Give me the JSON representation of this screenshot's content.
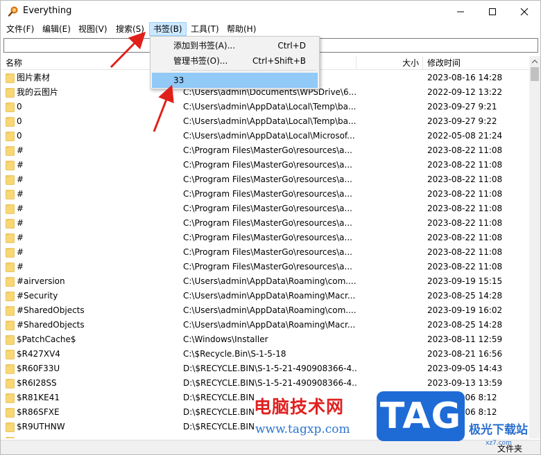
{
  "window": {
    "title": "Everything"
  },
  "menu": {
    "items": [
      "文件(F)",
      "编辑(E)",
      "视图(V)",
      "搜索(S)",
      "书签(B)",
      "工具(T)",
      "帮助(H)"
    ],
    "active_index": 4
  },
  "search": {
    "value": ""
  },
  "columns": {
    "name": "名称",
    "path": "",
    "size": "大小",
    "modified": "修改时间"
  },
  "bookmarks_menu": {
    "items": [
      {
        "label": "添加到书签(A)...",
        "shortcut": "Ctrl+D"
      },
      {
        "label": "管理书签(O)...",
        "shortcut": "Ctrl+Shift+B"
      }
    ],
    "bookmarks": [
      {
        "label": "33"
      }
    ]
  },
  "rows": [
    {
      "name": "图片素材",
      "path": "",
      "modified": "2023-08-16 14:28",
      "icon": "folder"
    },
    {
      "name": "我的云图片",
      "path": "C:\\Users\\admin\\Documents\\WPSDrive\\6...",
      "modified": "2022-09-12 13:22",
      "icon": "folder"
    },
    {
      "name": "0",
      "path": "C:\\Users\\admin\\AppData\\Local\\Temp\\ba...",
      "modified": "2023-09-27 9:21",
      "icon": "folder"
    },
    {
      "name": "0",
      "path": "C:\\Users\\admin\\AppData\\Local\\Temp\\ba...",
      "modified": "2023-09-27 9:22",
      "icon": "folder"
    },
    {
      "name": "0",
      "path": "C:\\Users\\admin\\AppData\\Local\\Microsof...",
      "modified": "2022-05-08 21:24",
      "icon": "folder"
    },
    {
      "name": "#",
      "path": "C:\\Program Files\\MasterGo\\resources\\a...",
      "modified": "2023-08-22 11:08",
      "icon": "folder"
    },
    {
      "name": "#",
      "path": "C:\\Program Files\\MasterGo\\resources\\a...",
      "modified": "2023-08-22 11:08",
      "icon": "folder"
    },
    {
      "name": "#",
      "path": "C:\\Program Files\\MasterGo\\resources\\a...",
      "modified": "2023-08-22 11:08",
      "icon": "folder"
    },
    {
      "name": "#",
      "path": "C:\\Program Files\\MasterGo\\resources\\a...",
      "modified": "2023-08-22 11:08",
      "icon": "folder"
    },
    {
      "name": "#",
      "path": "C:\\Program Files\\MasterGo\\resources\\a...",
      "modified": "2023-08-22 11:08",
      "icon": "folder"
    },
    {
      "name": "#",
      "path": "C:\\Program Files\\MasterGo\\resources\\a...",
      "modified": "2023-08-22 11:08",
      "icon": "folder"
    },
    {
      "name": "#",
      "path": "C:\\Program Files\\MasterGo\\resources\\a...",
      "modified": "2023-08-22 11:08",
      "icon": "folder"
    },
    {
      "name": "#",
      "path": "C:\\Program Files\\MasterGo\\resources\\a...",
      "modified": "2023-08-22 11:08",
      "icon": "folder"
    },
    {
      "name": "#",
      "path": "C:\\Program Files\\MasterGo\\resources\\a...",
      "modified": "2023-08-22 11:08",
      "icon": "folder"
    },
    {
      "name": "#airversion",
      "path": "C:\\Users\\admin\\AppData\\Roaming\\com....",
      "modified": "2023-09-19 15:15",
      "icon": "folder"
    },
    {
      "name": "#Security",
      "path": "C:\\Users\\admin\\AppData\\Roaming\\Macr...",
      "modified": "2023-08-25 14:28",
      "icon": "folder"
    },
    {
      "name": "#SharedObjects",
      "path": "C:\\Users\\admin\\AppData\\Roaming\\com....",
      "modified": "2023-09-19 16:02",
      "icon": "folder"
    },
    {
      "name": "#SharedObjects",
      "path": "C:\\Users\\admin\\AppData\\Roaming\\Macr...",
      "modified": "2023-08-25 14:28",
      "icon": "folder"
    },
    {
      "name": "$PatchCache$",
      "path": "C:\\Windows\\Installer",
      "modified": "2023-08-11 12:59",
      "icon": "folder"
    },
    {
      "name": "$R427XV4",
      "path": "C:\\$Recycle.Bin\\S-1-5-18",
      "modified": "2023-08-21 16:56",
      "icon": "folder"
    },
    {
      "name": "$R60F33U",
      "path": "D:\\$RECYCLE.BIN\\S-1-5-21-490908366-4...",
      "modified": "2023-09-05 14:43",
      "icon": "folder"
    },
    {
      "name": "$R6I28SS",
      "path": "D:\\$RECYCLE.BIN\\S-1-5-21-490908366-4...",
      "modified": "2023-09-13 13:59",
      "icon": "folder"
    },
    {
      "name": "$R81KE41",
      "path": "D:\\$RECYCLE.BIN",
      "modified": "2023-09-06 8:12",
      "icon": "folder"
    },
    {
      "name": "$R86SFXE",
      "path": "D:\\$RECYCLE.BIN",
      "modified": "2023-09-06 8:12",
      "icon": "folder"
    },
    {
      "name": "$R9UTHNW",
      "path": "D:\\$RECYCLE.BIN",
      "modified": "14:43",
      "icon": "folder"
    },
    {
      "name": "",
      "path": "",
      "modified": "",
      "icon": "folder"
    }
  ],
  "status": {
    "text": "文件夹"
  },
  "watermark": {
    "site_name": "电脑技术网",
    "url": "www.tagxp.com",
    "tag": "TAG",
    "download": "极光下载站",
    "download_url": "xz7.com"
  },
  "colors": {
    "menu_active_bg": "#cce8ff",
    "dropdown_highlight": "#91c9f7",
    "folder": "#f8d775",
    "arrow": "#e0201a"
  }
}
